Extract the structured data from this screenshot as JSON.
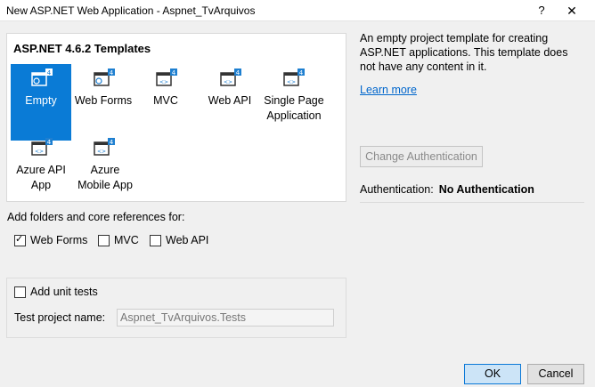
{
  "window": {
    "title": "New ASP.NET Web Application - Aspnet_TvArquivos",
    "help": "?",
    "close": "✕"
  },
  "templates": {
    "heading": "ASP.NET 4.6.2 Templates",
    "items": [
      {
        "label": "Empty",
        "selected": true,
        "icon": "empty-template-icon"
      },
      {
        "label": "Web Forms",
        "selected": false,
        "icon": "web-forms-template-icon"
      },
      {
        "label": "MVC",
        "selected": false,
        "icon": "mvc-template-icon"
      },
      {
        "label": "Web API",
        "selected": false,
        "icon": "web-api-template-icon"
      },
      {
        "label": "Single Page Application",
        "selected": false,
        "icon": "spa-template-icon"
      },
      {
        "label": "Azure API App",
        "selected": false,
        "icon": "azure-api-template-icon"
      },
      {
        "label": "Azure Mobile App",
        "selected": false,
        "icon": "azure-mobile-template-icon"
      }
    ]
  },
  "description": "An empty project template for creating ASP.NET applications. This template does not have any content in it.",
  "learn_more": "Learn more",
  "change_auth": "Change Authentication",
  "auth": {
    "label": "Authentication:",
    "value": "No Authentication"
  },
  "folders": {
    "label": "Add folders and core references for:",
    "web_forms": "Web Forms",
    "mvc": "MVC",
    "web_api": "Web API"
  },
  "unit_tests": {
    "label": "Add unit tests",
    "test_name_label": "Test project name:",
    "test_name_value": "Aspnet_TvArquivos.Tests"
  },
  "buttons": {
    "ok": "OK",
    "cancel": "Cancel"
  },
  "colors": {
    "accent": "#0a7bd6",
    "ok_bg": "#cce4f7",
    "link": "#0066cc"
  }
}
